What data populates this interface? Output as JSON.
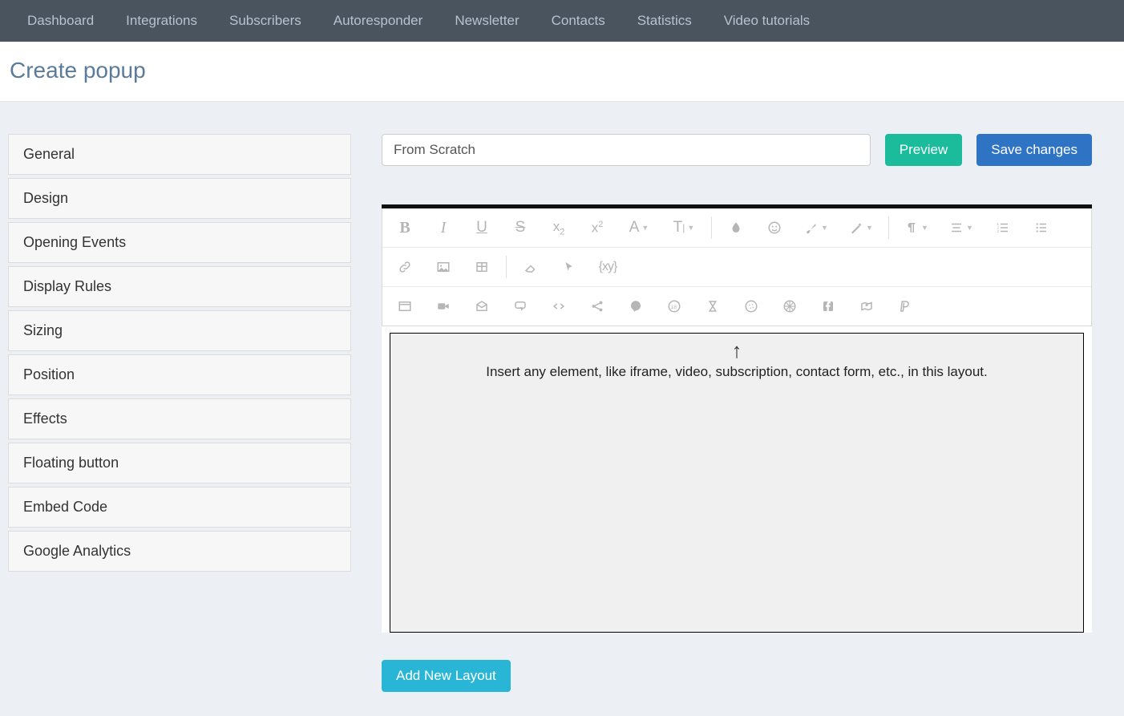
{
  "nav": {
    "items": [
      "Dashboard",
      "Integrations",
      "Subscribers",
      "Autoresponder",
      "Newsletter",
      "Contacts",
      "Statistics",
      "Video tutorials"
    ]
  },
  "page": {
    "title": "Create popup"
  },
  "sidebar": {
    "items": [
      "General",
      "Design",
      "Opening Events",
      "Display Rules",
      "Sizing",
      "Position",
      "Effects",
      "Floating button",
      "Embed Code",
      "Google Analytics"
    ]
  },
  "editor": {
    "name_value": "From Scratch",
    "preview_label": "Preview",
    "save_label": "Save changes",
    "add_layout_label": "Add New Layout",
    "placeholder_arrow": "↑",
    "placeholder_text": "Insert any element, like iframe, video, subscription, contact form, etc., in this layout."
  },
  "toolbar": {
    "row1_labels": {
      "bold": "B",
      "italic": "I",
      "underline": "U",
      "strike": "S",
      "subscript": "x",
      "superscript": "x",
      "font": "A",
      "textsize": "T"
    }
  }
}
